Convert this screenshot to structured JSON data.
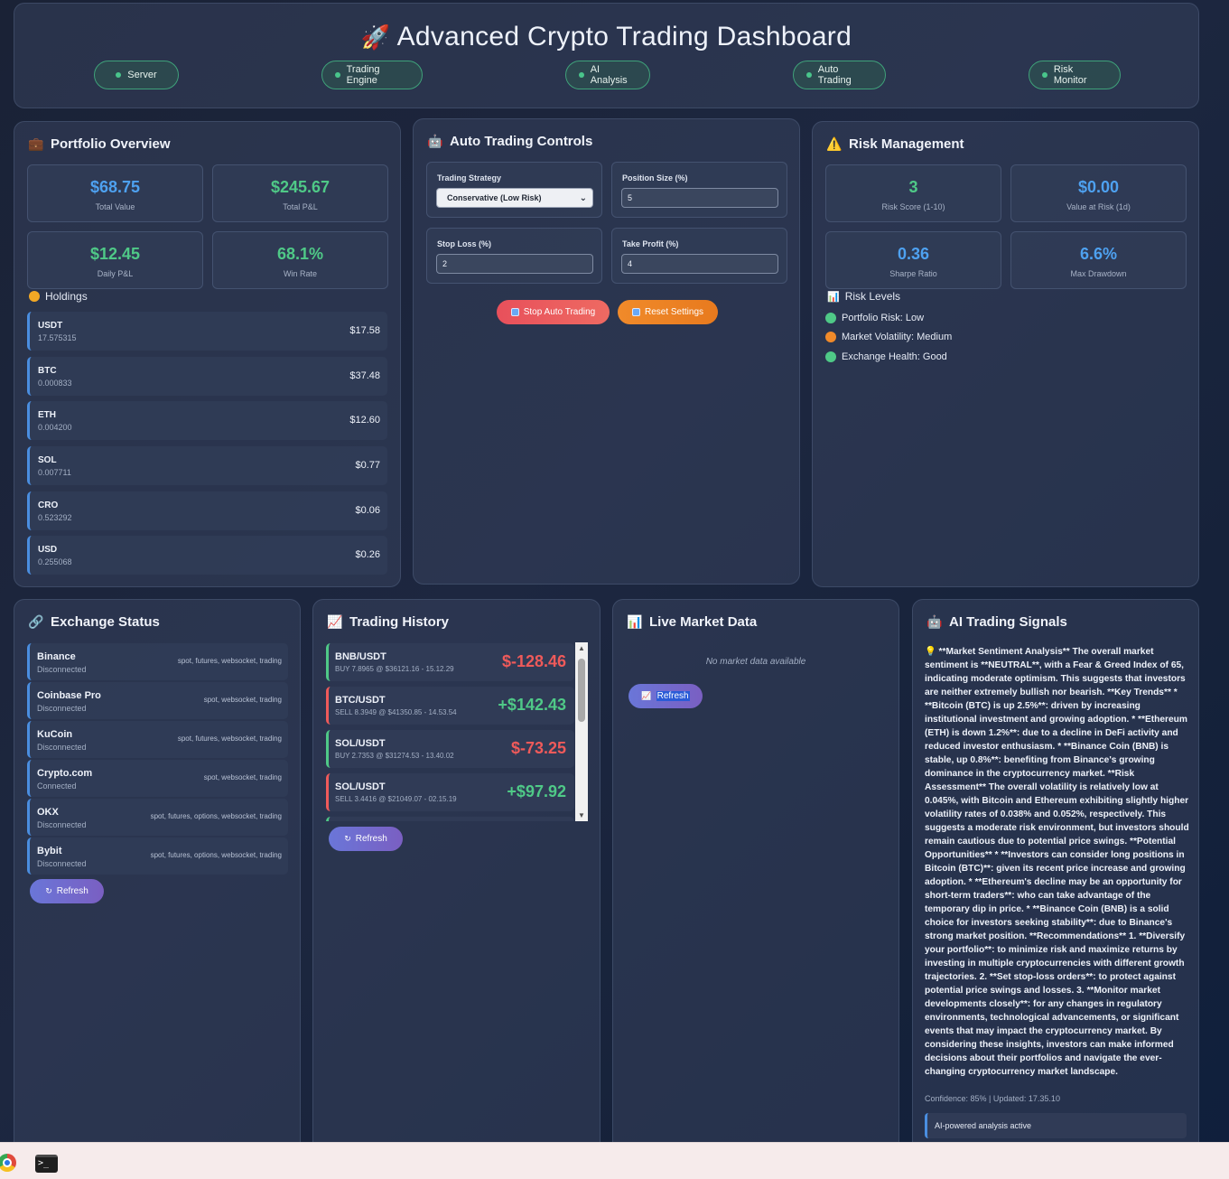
{
  "header": {
    "title": "Advanced Crypto Trading Dashboard",
    "statuses": [
      "Server",
      "Trading Engine",
      "AI Analysis",
      "Auto Trading",
      "Risk Monitor"
    ]
  },
  "portfolio": {
    "title": "Portfolio Overview",
    "stats": [
      {
        "value": "$68.75",
        "label": "Total Value"
      },
      {
        "value": "$245.67",
        "label": "Total P&L"
      },
      {
        "value": "$12.45",
        "label": "Daily P&L"
      },
      {
        "value": "68.1%",
        "label": "Win Rate"
      }
    ],
    "holdings_title": "Holdings",
    "holdings": [
      {
        "symbol": "USDT",
        "amount": "17.575315",
        "value": "$17.58"
      },
      {
        "symbol": "BTC",
        "amount": "0.000833",
        "value": "$37.48"
      },
      {
        "symbol": "ETH",
        "amount": "0.004200",
        "value": "$12.60"
      },
      {
        "symbol": "SOL",
        "amount": "0.007711",
        "value": "$0.77"
      },
      {
        "symbol": "CRO",
        "amount": "0.523292",
        "value": "$0.06"
      },
      {
        "symbol": "USD",
        "amount": "0.255068",
        "value": "$0.26"
      }
    ]
  },
  "auto_trading": {
    "title": "Auto Trading Controls",
    "strategy_label": "Trading Strategy",
    "strategy_value": "Conservative (Low Risk)",
    "position_label": "Position Size (%)",
    "position_value": "5",
    "stoploss_label": "Stop Loss (%)",
    "stoploss_value": "2",
    "takeprofit_label": "Take Profit (%)",
    "takeprofit_value": "4",
    "stop_button": "Stop Auto Trading",
    "reset_button": "Reset Settings"
  },
  "risk": {
    "title": "Risk Management",
    "stats": [
      {
        "value": "3",
        "label": "Risk Score (1-10)"
      },
      {
        "value": "$0.00",
        "label": "Value at Risk (1d)"
      },
      {
        "value": "0.36",
        "label": "Sharpe Ratio"
      },
      {
        "value": "6.6%",
        "label": "Max Drawdown"
      }
    ],
    "levels_title": "Risk Levels",
    "levels": [
      {
        "text": "Portfolio Risk: Low",
        "color": "#4fc987"
      },
      {
        "text": "Market Volatility: Medium",
        "color": "#f08a2a"
      },
      {
        "text": "Exchange Health: Good",
        "color": "#4fc987"
      }
    ]
  },
  "exchange": {
    "title": "Exchange Status",
    "items": [
      {
        "name": "Binance",
        "status": "Disconnected",
        "caps": "spot, futures, websocket, trading"
      },
      {
        "name": "Coinbase Pro",
        "status": "Disconnected",
        "caps": "spot, websocket, trading"
      },
      {
        "name": "KuCoin",
        "status": "Disconnected",
        "caps": "spot, futures, websocket, trading"
      },
      {
        "name": "Crypto.com",
        "status": "Connected",
        "caps": "spot, websocket, trading"
      },
      {
        "name": "OKX",
        "status": "Disconnected",
        "caps": "spot, futures, options, websocket, trading"
      },
      {
        "name": "Bybit",
        "status": "Disconnected",
        "caps": "spot, futures, options, websocket, trading"
      }
    ],
    "refresh": "Refresh"
  },
  "history": {
    "title": "Trading History",
    "trades": [
      {
        "pair": "BNB/USDT",
        "detail": "BUY 7.8965 @ $36121.16 - 15.12.29",
        "pnl": "$-128.46",
        "side": "buy",
        "positive": false
      },
      {
        "pair": "BTC/USDT",
        "detail": "SELL 8.3949 @ $41350.85 - 14.53.54",
        "pnl": "+$142.43",
        "side": "sell",
        "positive": true
      },
      {
        "pair": "SOL/USDT",
        "detail": "BUY 2.7353 @ $31274.53 - 13.40.02",
        "pnl": "$-73.25",
        "side": "buy",
        "positive": false
      },
      {
        "pair": "SOL/USDT",
        "detail": "SELL 3.4416 @ $21049.07 - 02.15.19",
        "pnl": "+$97.92",
        "side": "sell",
        "positive": true
      }
    ],
    "refresh": "Refresh"
  },
  "market": {
    "title": "Live Market Data",
    "empty": "No market data available",
    "refresh": "Refresh"
  },
  "ai": {
    "title": "AI Trading Signals",
    "analysis": "**Market Sentiment Analysis** The overall market sentiment is **NEUTRAL**, with a Fear & Greed Index of 65, indicating moderate optimism. This suggests that investors are neither extremely bullish nor bearish. **Key Trends** * **Bitcoin (BTC) is up 2.5%**: driven by increasing institutional investment and growing adoption. * **Ethereum (ETH) is down 1.2%**: due to a decline in DeFi activity and reduced investor enthusiasm. * **Binance Coin (BNB) is stable, up 0.8%**: benefiting from Binance's growing dominance in the cryptocurrency market. **Risk Assessment** The overall volatility is relatively low at 0.045%, with Bitcoin and Ethereum exhibiting slightly higher volatility rates of 0.038% and 0.052%, respectively. This suggests a moderate risk environment, but investors should remain cautious due to potential price swings. **Potential Opportunities** * **Investors can consider long positions in Bitcoin (BTC)**: given its recent price increase and growing adoption. * **Ethereum's decline may be an opportunity for short-term traders**: who can take advantage of the temporary dip in price. * **Binance Coin (BNB) is a solid choice for investors seeking stability**: due to Binance's strong market position. **Recommendations** 1. **Diversify your portfolio**: to minimize risk and maximize returns by investing in multiple cryptocurrencies with different growth trajectories. 2. **Set stop-loss orders**: to protect against potential price swings and losses. 3. **Monitor market developments closely**: for any changes in regulatory environments, technological advancements, or significant events that may impact the cryptocurrency market. By considering these insights, investors can make informed decisions about their portfolios and navigate the ever-changing cryptocurrency market landscape.",
    "meta": "Confidence: 85% | Updated: 17.35.10",
    "status": "AI-powered analysis active"
  },
  "colors": {
    "green": "#4fc987",
    "red": "#ef5a5a",
    "blue": "#4ea1f0",
    "orange": "#f08a2a"
  },
  "icons": [
    "rocket-icon",
    "briefcase-icon",
    "robot-icon",
    "warning-icon",
    "coin-icon",
    "bar-chart-icon",
    "link-icon",
    "trend-icon",
    "refresh-icon",
    "lightbulb-icon",
    "chrome-icon",
    "terminal-icon"
  ]
}
